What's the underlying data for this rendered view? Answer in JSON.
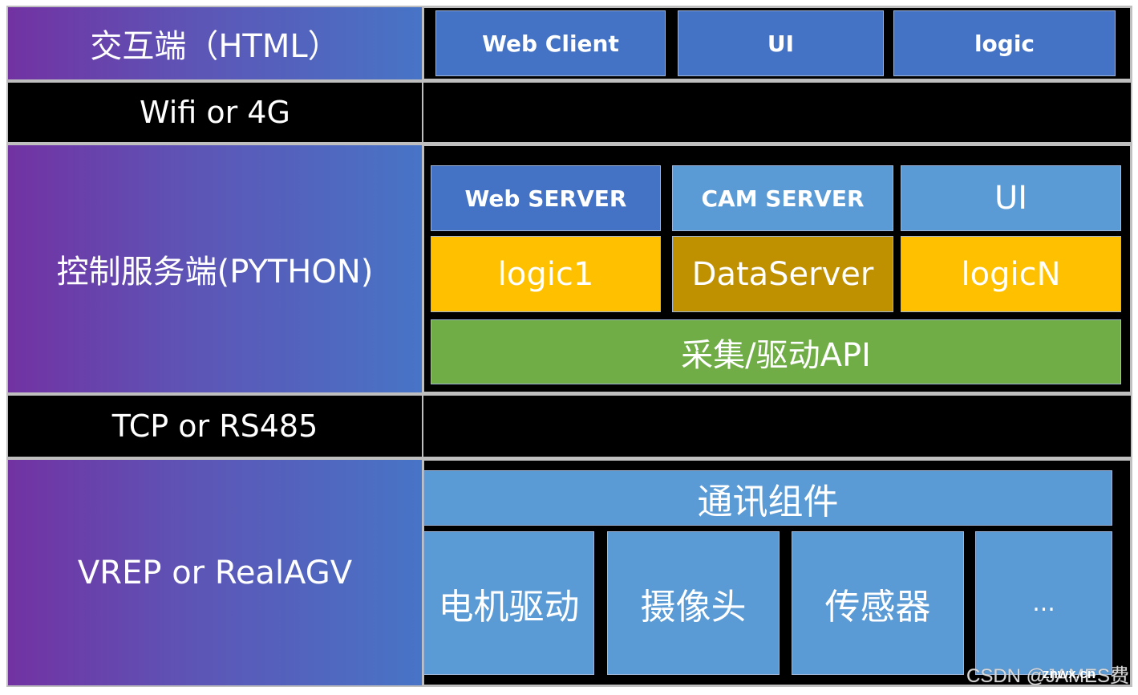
{
  "layers": {
    "interaction": "交互端（HTML）",
    "network": "Wifi or 4G",
    "control": "控制服务端(PYTHON)",
    "bus": "TCP or RS485",
    "device": "VREP or RealAGV"
  },
  "interaction_boxes": [
    "Web Client",
    "UI",
    "logic"
  ],
  "control_boxes": {
    "servers": [
      "Web SERVER",
      "CAM SERVER",
      "UI"
    ],
    "logic": [
      "logic1",
      "DataServer",
      "logicN"
    ],
    "api": "采集/驱动API"
  },
  "device_boxes": {
    "comm": "通讯组件",
    "modules": [
      "电机驱动",
      "摄像头",
      "传感器",
      "..."
    ]
  },
  "watermark": {
    "text": "CSDN @JAMES费",
    "overlay": "znwx.cn"
  },
  "colors": {
    "dark_blue": "#4472c4",
    "light_blue": "#5b9bd5",
    "yellow": "#ffc000",
    "dark_yellow": "#bf9000",
    "green": "#70ad47",
    "purple": "#7030a0"
  }
}
